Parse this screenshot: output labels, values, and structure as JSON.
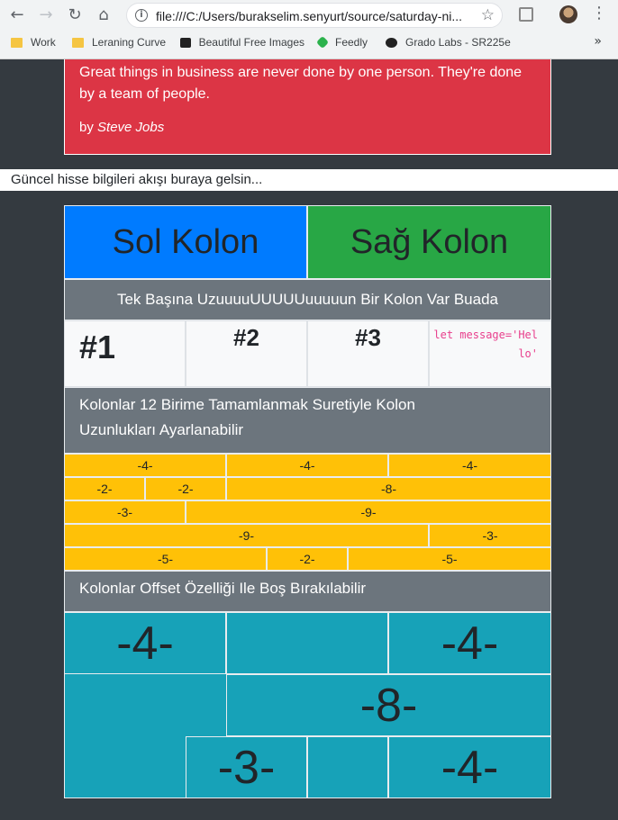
{
  "browser": {
    "url": "file:///C:/Users/burakselim.senyurt/source/saturday-ni...",
    "bookmarks": [
      {
        "label": "Work",
        "icon": "folder-icon"
      },
      {
        "label": "Leraning Curve",
        "icon": "folder-icon"
      },
      {
        "label": "Beautiful Free Images",
        "icon": "camera-icon"
      },
      {
        "label": "Feedly",
        "icon": "feedly-icon"
      },
      {
        "label": "Grado Labs - SR225e",
        "icon": "grado-icon"
      }
    ],
    "more_label": "»"
  },
  "quote": {
    "text": "Great things in business are never done by one person. They're done by a team of people.",
    "by_prefix": "by ",
    "author": "Steve Jobs"
  },
  "ticker": "Güncel hisse bilgileri akışı buraya gelsin...",
  "grid": {
    "left_col": "Sol Kolon",
    "right_col": "Sağ Kolon",
    "single_col": "Tek Başına UzuuuuUUUUUuuuuun Bir Kolon Var Buada",
    "num1": "#1",
    "num2": "#2",
    "num3": "#3",
    "code": "let message='Hello'",
    "twelve_title": "Kolonlar 12 Birime Tamamlanmak Suretiyle Kolon Uzunlukları Ayarlanabilir",
    "offset_title": "Kolonlar Offset Özelliği Ile Boş Bırakılabilir",
    "yellow_rows": [
      [
        "-4-",
        "-4-",
        "-4-"
      ],
      [
        "-2-",
        "-2-",
        "-8-"
      ],
      [
        "-3-",
        "-9-"
      ],
      [
        "-9-",
        "-3-"
      ],
      [
        "-5-",
        "-2-",
        "-5-"
      ]
    ],
    "teal": [
      "-4-",
      "-4-",
      "-8-",
      "-3-",
      "-4-"
    ]
  },
  "colors": {
    "danger": "#dc3545",
    "primary": "#007bff",
    "success": "#28a745",
    "secondary": "#6c757d",
    "warning": "#ffc107",
    "info": "#17a2b8",
    "dark": "#343a40"
  }
}
